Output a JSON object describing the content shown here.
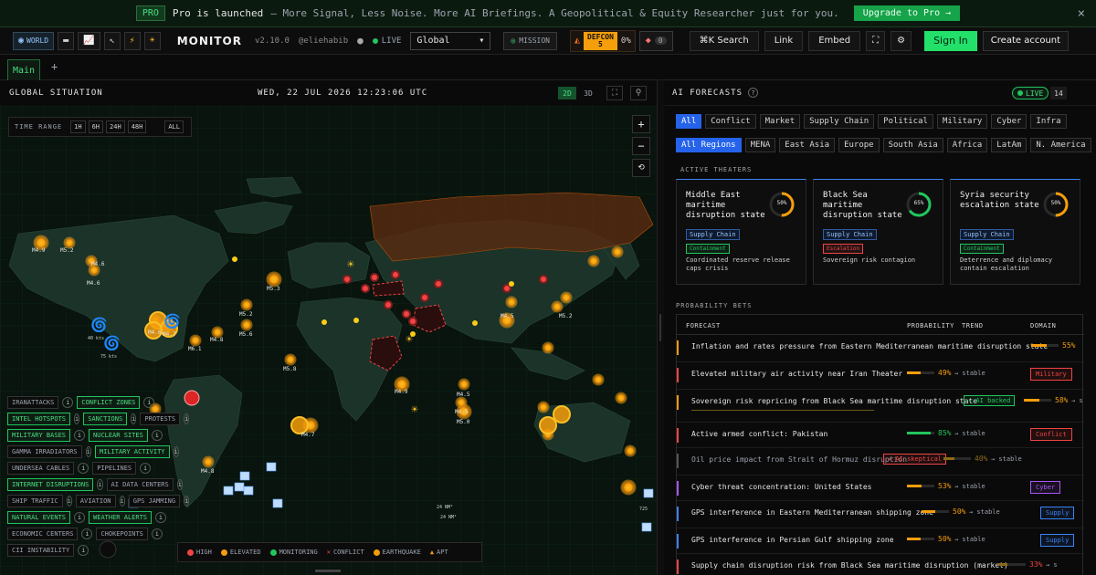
{
  "banner": {
    "tag": "PRO",
    "headline": "Pro is launched",
    "subtext": "– More Signal, Less Noise. More AI Briefings. A Geopolitical & Equity Researcher just for you.",
    "cta": "Upgrade to Pro →",
    "close": "×"
  },
  "topbar": {
    "world_label": "WORLD",
    "brand": "MONITOR",
    "version": "v2.10.0",
    "handle": "@eliehabib",
    "live_label": "LIVE",
    "region_select": "Global",
    "mission_label": "MISSION",
    "defcon_label": "DEFCON",
    "defcon_level": "5",
    "defcon_pct": "0%",
    "alerts_count": "0",
    "search_label": "⌘K Search",
    "link_label": "Link",
    "embed_label": "Embed",
    "signin_label": "Sign In",
    "create_label": "Create account"
  },
  "tabs": {
    "main": "Main",
    "add": "+"
  },
  "map": {
    "title": "GLOBAL SITUATION",
    "clock": "WED, 22 JUL 2026 12:23:06 UTC",
    "mode_2d": "2D",
    "mode_3d": "3D",
    "time_range_label": "TIME RANGE",
    "time_ranges": [
      "1H",
      "6H",
      "24H",
      "48H"
    ],
    "time_all": "ALL",
    "zoom_in": "+",
    "zoom_out": "−",
    "reset": "⟲",
    "quake_labels": [
      "M4.9",
      "M5.2",
      "M4.6",
      "M4.6",
      "M5.3",
      "M5.2",
      "M5.6",
      "M6.1",
      "M4.7",
      "M4.6",
      "M4.8",
      "M4.5",
      "M4.9",
      "M5.2",
      "M4.5",
      "M5.8",
      "M5.0",
      "M4.5",
      "M4.5",
      "M4.8",
      "M4.7"
    ],
    "wind_labels": [
      "40 kts",
      "75 kts",
      "24 NM²",
      "725",
      "24 NM²"
    ],
    "layers": [
      [
        {
          "label": "IRANATTACKS",
          "on": false
        },
        {
          "label": "CONFLICT ZONES",
          "on": true
        }
      ],
      [
        {
          "label": "INTEL HOTSPOTS",
          "on": true
        },
        {
          "label": "SANCTIONS",
          "on": true
        },
        {
          "label": "PROTESTS",
          "on": false
        }
      ],
      [
        {
          "label": "MILITARY BASES",
          "on": true
        },
        {
          "label": "NUCLEAR SITES",
          "on": true
        }
      ],
      [
        {
          "label": "GAMMA IRRADIATORS",
          "on": false
        },
        {
          "label": "MILITARY ACTIVITY",
          "on": true
        }
      ],
      [
        {
          "label": "UNDERSEA CABLES",
          "on": false
        },
        {
          "label": "PIPELINES",
          "on": false
        }
      ],
      [
        {
          "label": "INTERNET DISRUPTIONS",
          "on": true
        },
        {
          "label": "AI DATA CENTERS",
          "on": false
        }
      ],
      [
        {
          "label": "SHIP TRAFFIC",
          "on": false
        },
        {
          "label": "AVIATION",
          "on": false
        },
        {
          "label": "GPS JAMMING",
          "on": false
        }
      ],
      [
        {
          "label": "NATURAL EVENTS",
          "on": true
        },
        {
          "label": "WEATHER ALERTS",
          "on": true
        }
      ],
      [
        {
          "label": "ECONOMIC CENTERS",
          "on": false
        },
        {
          "label": "CHOKEPOINTS",
          "on": false
        }
      ],
      [
        {
          "label": "CII INSTABILITY",
          "on": false
        }
      ]
    ],
    "legend": [
      {
        "label": "HIGH",
        "color": "#ef4444",
        "kind": "dot"
      },
      {
        "label": "ELEVATED",
        "color": "#f59e0b",
        "kind": "dot"
      },
      {
        "label": "MONITORING",
        "color": "#22c55e",
        "kind": "dot"
      },
      {
        "label": "CONFLICT",
        "color": "#ef4444",
        "kind": "x"
      },
      {
        "label": "EARTHQUAKE",
        "color": "#f59e0b",
        "kind": "dot"
      },
      {
        "label": "APT",
        "color": "#f59e0b",
        "kind": "tri"
      }
    ]
  },
  "forecasts": {
    "title": "AI FORECASTS",
    "help": "?",
    "live": "LIVE",
    "count": "14",
    "categories": [
      {
        "label": "All",
        "on": true
      },
      {
        "label": "Conflict",
        "on": false
      },
      {
        "label": "Market",
        "on": false
      },
      {
        "label": "Supply Chain",
        "on": false
      },
      {
        "label": "Political",
        "on": false
      },
      {
        "label": "Military",
        "on": false
      },
      {
        "label": "Cyber",
        "on": false
      },
      {
        "label": "Infra",
        "on": false
      }
    ],
    "regions": [
      {
        "label": "All Regions",
        "on": true
      },
      {
        "label": "MENA",
        "on": false
      },
      {
        "label": "East Asia",
        "on": false
      },
      {
        "label": "Europe",
        "on": false
      },
      {
        "label": "South Asia",
        "on": false
      },
      {
        "label": "Africa",
        "on": false
      },
      {
        "label": "LatAm",
        "on": false
      },
      {
        "label": "N. America",
        "on": false
      }
    ],
    "active_theaters_label": "ACTIVE THEATERS",
    "theaters": [
      {
        "name": "Middle East maritime disruption state",
        "pct": "50%",
        "value": 50,
        "color": "#f59e0b",
        "tag": "Supply Chain",
        "status": "Containment",
        "status_color": "#22c55e",
        "desc": "Coordinated reserve release caps crisis"
      },
      {
        "name": "Black Sea maritime disruption state",
        "pct": "65%",
        "value": 65,
        "color": "#22c55e",
        "tag": "Supply Chain",
        "status": "Escalation",
        "status_color": "#ef4444",
        "desc": "Sovereign risk contagion"
      },
      {
        "name": "Syria security escalation state",
        "pct": "50%",
        "value": 50,
        "color": "#f59e0b",
        "tag": "Supply Chain",
        "status": "Containment",
        "status_color": "#22c55e",
        "desc": "Deterrence and diplomacy contain escalation"
      }
    ],
    "bets_label": "PROBABILITY BETS",
    "columns": {
      "forecast": "FORECAST",
      "probability": "PROBABILITY",
      "trend": "TREND",
      "domain": "DOMAIN"
    },
    "rows": [
      {
        "q": "Inflation and rates pressure from Eastern Mediterranean maritime disruption state",
        "pct": "55%",
        "value": 55,
        "trend": "",
        "domain": "",
        "accent": "#f59e0b",
        "ai": ""
      },
      {
        "q": "Elevated military air activity near Iran Theater",
        "pct": "49%",
        "value": 49,
        "trend": "→ stable",
        "domain": "Military",
        "accent": "#ef4444",
        "ai": ""
      },
      {
        "q": "Sovereign risk repricing from Black Sea maritime disruption state",
        "pct": "58%",
        "value": 58,
        "trend": "→ s",
        "domain": "",
        "accent": "#f59e0b",
        "ai": "✦ AI backed"
      },
      {
        "q": "Active armed conflict: Pakistan",
        "pct": "85%",
        "value": 85,
        "trend": "→ stable",
        "domain": "Conflict",
        "accent": "#ef4444",
        "ai": ""
      },
      {
        "q": "Oil price impact from Strait of Hormuz disruption",
        "pct": "40%",
        "value": 40,
        "trend": "→ stable",
        "domain": "",
        "accent": "#555",
        "ai": "✦ AI skeptical"
      },
      {
        "q": "Cyber threat concentration: United States",
        "pct": "53%",
        "value": 53,
        "trend": "→ stable",
        "domain": "Cyber",
        "accent": "#a855f7",
        "ai": ""
      },
      {
        "q": "GPS interference in Eastern Mediterranean shipping zone",
        "pct": "50%",
        "value": 50,
        "trend": "→ stable",
        "domain": "Supply",
        "accent": "#3b82f6",
        "ai": ""
      },
      {
        "q": "GPS interference in Persian Gulf shipping zone",
        "pct": "50%",
        "value": 50,
        "trend": "→ stable",
        "domain": "Supply",
        "accent": "#3b82f6",
        "ai": ""
      },
      {
        "q": "Supply chain disruption risk from Black Sea maritime disruption (market)",
        "pct": "33%",
        "value": 33,
        "trend": "→ s",
        "domain": "",
        "accent": "#ef4444",
        "ai": ""
      }
    ]
  }
}
